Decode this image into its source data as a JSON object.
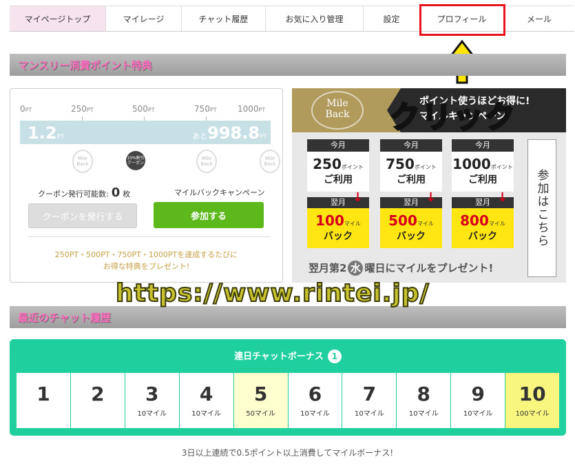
{
  "nav": {
    "items": [
      {
        "label": "マイページトップ",
        "active": true
      },
      {
        "label": "マイレージ"
      },
      {
        "label": "チャット履歴"
      },
      {
        "label": "お気に入り管理"
      },
      {
        "label": "設定"
      },
      {
        "label": "プロフィール",
        "highlighted": true
      },
      {
        "label": "メール"
      }
    ]
  },
  "monthly": {
    "section_title": "マンスリー消費ポイント特典",
    "ticks": [
      "0",
      "250",
      "500",
      "750",
      "1000"
    ],
    "tick_unit": "PT",
    "current_value": "1.2",
    "current_unit": "PT",
    "remaining_prefix": "あと",
    "remaining_value": "998.8",
    "remaining_unit": "PT",
    "progress_fraction": 0.0012,
    "medal_text": "Mile Back",
    "coupon_dot_text": "10%割引 クーポン",
    "coupon_count_label": "クーポン発行可能数:",
    "coupon_count": "0",
    "coupon_count_unit": "枚",
    "mileback_label": "マイルバックキャンペーン",
    "issue_coupon_button": "クーポンを発行する",
    "join_button": "参加する",
    "note_line1": "250PT・500PT・750PT・1000PTを達成するたびに",
    "note_line2": "お得な特典をプレゼント!"
  },
  "banner": {
    "logo_line1": "Mile",
    "logo_line2": "Back",
    "headline_line1": "ポイント使うほどお得に!",
    "headline_line2": "マイルキャンペーン",
    "this_month": "今月",
    "next_month": "翌月",
    "columns": [
      {
        "use_points": "250",
        "use_unit": "ポイント",
        "use_label": "ご利用",
        "back_miles": "100",
        "back_unit": "マイル",
        "back_label": "バック"
      },
      {
        "use_points": "750",
        "use_unit": "ポイント",
        "use_label": "ご利用",
        "back_miles": "500",
        "back_unit": "マイル",
        "back_label": "バック"
      },
      {
        "use_points": "1000",
        "use_unit": "ポイント",
        "use_label": "ご利用",
        "back_miles": "800",
        "back_unit": "マイル",
        "back_label": "バック"
      }
    ],
    "join_here": "参加はこちら",
    "footer_pre": "翌月第2",
    "footer_circle": "水",
    "footer_post": "曜日にマイルをプレゼント!"
  },
  "annotation": {
    "click_text": "クリック",
    "watermark": "https://www.rintei.jp/"
  },
  "chat_history": {
    "section_title": "最近のチャット履歴",
    "bonus_title": "連日チャットボーナス",
    "bonus_badge": "1",
    "days": [
      {
        "day": "1",
        "miles": ""
      },
      {
        "day": "2",
        "miles": ""
      },
      {
        "day": "3",
        "miles": "10マイル"
      },
      {
        "day": "4",
        "miles": "10マイル"
      },
      {
        "day": "5",
        "miles": "50マイル"
      },
      {
        "day": "6",
        "miles": "10マイル"
      },
      {
        "day": "7",
        "miles": "10マイル"
      },
      {
        "day": "8",
        "miles": "10マイル"
      },
      {
        "day": "9",
        "miles": "10マイル"
      },
      {
        "day": "10",
        "miles": "100マイル"
      }
    ],
    "footnote": "3日以上連続で0.5ポイント以上消費してマイルボーナス!"
  },
  "colors": {
    "accent_pink": "#ff6fc0",
    "green_button": "#5cb81b",
    "bonus_teal": "#1fd09e",
    "highlight_red": "#e8111c",
    "click_yellow": "#ffe600"
  }
}
